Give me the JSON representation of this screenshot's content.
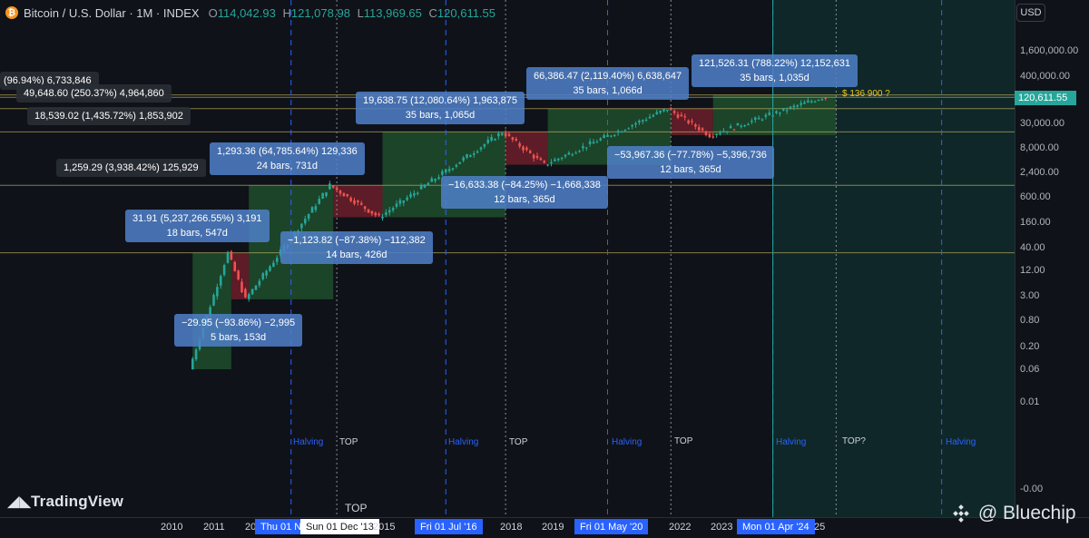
{
  "header": {
    "coin_icon": "bitcoin-icon",
    "title": "Bitcoin / U.S. Dollar · 1M · INDEX",
    "o_label": "O",
    "o": "114,042.93",
    "h_label": "H",
    "h": "121,078.98",
    "l_label": "L",
    "l": "113,969.65",
    "c_label": "C",
    "c": "120,611.55"
  },
  "price_axis": {
    "currency": "USD",
    "ticks": [
      "1,600,000.00",
      "400,000.00",
      "120,611.55",
      "30,000.00",
      "8,000.00",
      "2,400.00",
      "600.00",
      "160.00",
      "40.00",
      "12.00",
      "3.00",
      "0.80",
      "0.20",
      "0.06",
      "0.01",
      "-0.00"
    ],
    "last_price": "120,611.55"
  },
  "time_axis": {
    "labels": [
      "2010",
      "2011",
      "20",
      "2015",
      "2018",
      "2019",
      "2022",
      "2023",
      "25"
    ],
    "badges": [
      "Thu 01 N",
      "Sun 01 Dec '13",
      "Fri 01 Jul '16",
      "Fri 01 May '20",
      "Mon 01 Apr '24"
    ]
  },
  "events": {
    "halving": "Halving",
    "top": "TOP",
    "top_q": "TOP?",
    "top_axis": "TOP"
  },
  "measure_boxes": [
    {
      "l1": "(96.94%) 6,733,846",
      "l2": ""
    },
    {
      "l1": "49,648.60 (250.37%) 4,964,860",
      "l2": ""
    },
    {
      "l1": "18,539.02 (1,435.72%) 1,853,902",
      "l2": ""
    },
    {
      "l1": "1,259.29 (3,938.42%) 125,929",
      "l2": ""
    },
    {
      "l1": "31.91 (5,237,266.55%) 3,191",
      "l2": "18 bars, 547d"
    },
    {
      "l1": "1,293.36 (64,785.64%) 129,336",
      "l2": "24 bars, 731d"
    },
    {
      "l1": "−1,123.82 (−87.38%) −112,382",
      "l2": "14 bars, 426d"
    },
    {
      "l1": "−29.95 (−93.86%) −2,995",
      "l2": "5 bars, 153d"
    },
    {
      "l1": "19,638.75 (12,080.64%) 1,963,875",
      "l2": "35 bars, 1,065d"
    },
    {
      "l1": "−16,633.38 (−84.25%) −1,668,338",
      "l2": "12 bars, 365d"
    },
    {
      "l1": "66,386.47 (2,119.40%) 6,638,647",
      "l2": "35 bars, 1,066d"
    },
    {
      "l1": "−53,967.36 (−77.78%) −5,396,736",
      "l2": "12 bars, 365d"
    },
    {
      "l1": "121,526.31 (788.22%) 12,152,631",
      "l2": "35 bars, 1,035d"
    }
  ],
  "target_label": "$ 136 900 ?",
  "brand": {
    "tradingview": "TradingView",
    "bluechip": "@ Bluechip"
  },
  "chart_data": {
    "type": "candlestick",
    "title": "Bitcoin / U.S. Dollar · 1M · INDEX",
    "scale": "log",
    "ylim": [
      0.01,
      1600000
    ],
    "candle_colors": {
      "up": "#26a69a",
      "down": "#ef5350"
    },
    "anchors": [
      {
        "date": "2010-07",
        "price": 0.06
      },
      {
        "date": "2011-06",
        "price": 30
      },
      {
        "date": "2011-11",
        "price": 2.5
      },
      {
        "date": "2013-11",
        "price": 1100
      },
      {
        "date": "2015-01",
        "price": 200
      },
      {
        "date": "2017-12",
        "price": 19000
      },
      {
        "date": "2018-12",
        "price": 3300
      },
      {
        "date": "2021-11",
        "price": 66000
      },
      {
        "date": "2022-11",
        "price": 16000
      },
      {
        "date": "2025-07",
        "price": 120611.55
      }
    ],
    "halvings": [
      "2012-11",
      "2016-07",
      "2020-05",
      "2024-04",
      "2028-04"
    ],
    "tops": [
      "2013-12",
      "2017-12",
      "2021-11",
      "2025-10"
    ]
  }
}
